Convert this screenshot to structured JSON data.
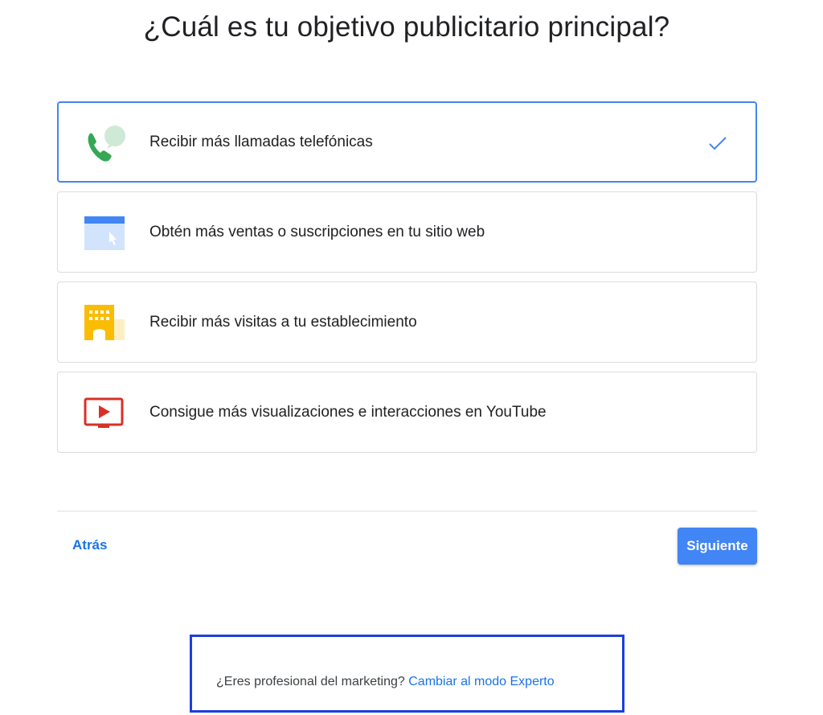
{
  "header": {
    "title": "¿Cuál es tu objetivo publicitario principal?"
  },
  "options": [
    {
      "label": "Recibir más llamadas telefónicas",
      "icon": "phone-call-icon",
      "selected": true
    },
    {
      "label": "Obtén más ventas o suscripciones en tu sitio web",
      "icon": "website-cursor-icon",
      "selected": false
    },
    {
      "label": "Recibir más visitas a tu establecimiento",
      "icon": "storefront-icon",
      "selected": false
    },
    {
      "label": "Consigue más visualizaciones e interacciones en YouTube",
      "icon": "youtube-play-icon",
      "selected": false
    }
  ],
  "navigation": {
    "back_label": "Atrás",
    "next_label": "Siguiente"
  },
  "expert_mode": {
    "question": "¿Eres profesional del marketing?",
    "link_label": "Cambiar al modo Experto"
  },
  "colors": {
    "accent": "#4285f4",
    "link": "#1a73e8",
    "highlight_box": "#1a3fe0"
  }
}
